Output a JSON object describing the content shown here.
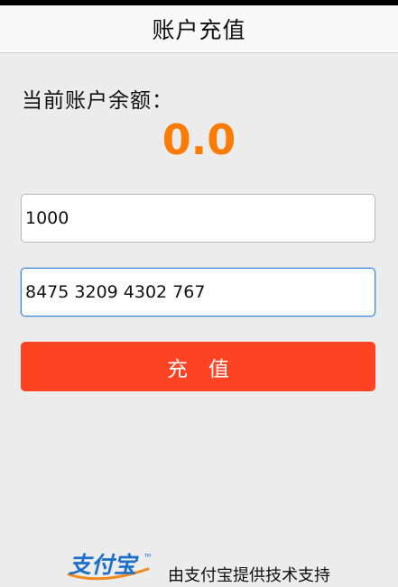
{
  "header": {
    "title": "账户充值"
  },
  "balance": {
    "label": "当前账户余额：",
    "value": "0.0",
    "value_color": "#fa7b05"
  },
  "form": {
    "amount_value": "1000",
    "card_number_value": "8475 3209 4302 767",
    "submit_label": "充　值",
    "submit_color": "#fe4322",
    "focus_color": "#3b86d6"
  },
  "footer": {
    "brand_logo_text": "支付宝",
    "brand_icon": "alipay-logo",
    "brand_accent": "#1e6fc8",
    "brand_swoosh": "#f08a1c",
    "support_text": "由支付宝提供技术支持"
  }
}
